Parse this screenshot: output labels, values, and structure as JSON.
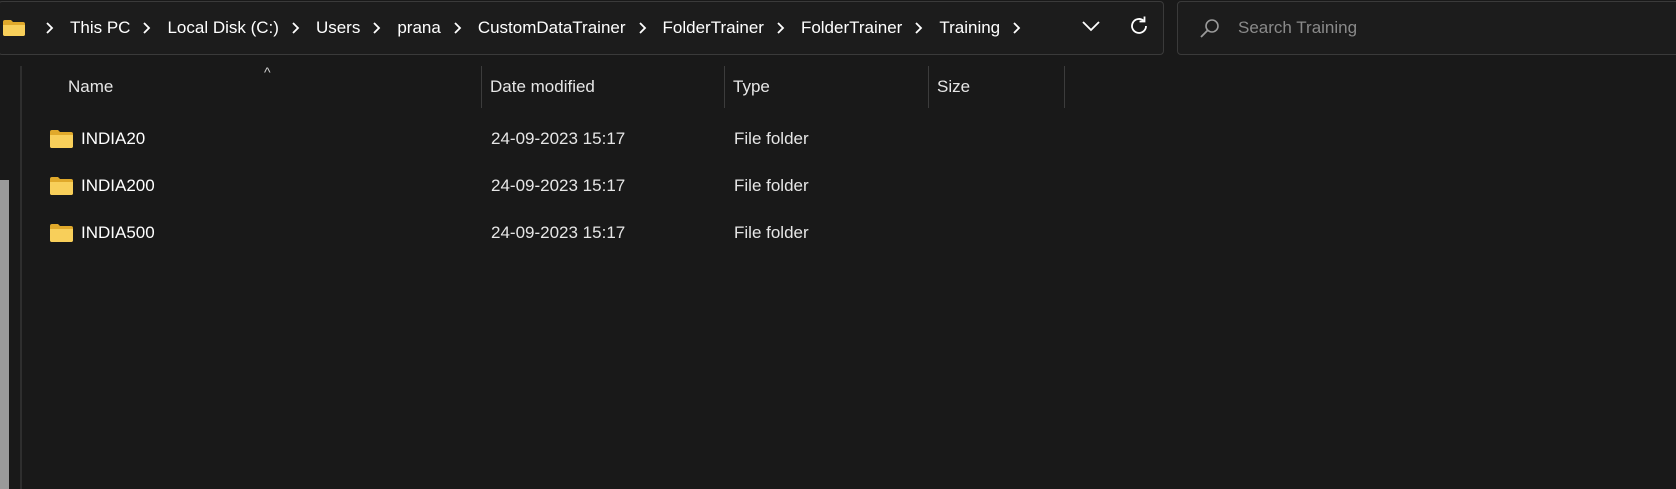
{
  "address_bar": {
    "crumbs": [
      "This PC",
      "Local Disk (C:)",
      "Users",
      "prana",
      "CustomDataTrainer",
      "FolderTrainer",
      "FolderTrainer",
      "Training"
    ]
  },
  "search": {
    "placeholder": "Search Training"
  },
  "columns": {
    "name": "Name",
    "date_modified": "Date modified",
    "type": "Type",
    "size": "Size",
    "sort_indicator": "^"
  },
  "files": [
    {
      "name": "INDIA20",
      "date_modified": "24-09-2023 15:17",
      "type": "File folder",
      "size": ""
    },
    {
      "name": "INDIA200",
      "date_modified": "24-09-2023 15:17",
      "type": "File folder",
      "size": ""
    },
    {
      "name": "INDIA500",
      "date_modified": "24-09-2023 15:17",
      "type": "File folder",
      "size": ""
    }
  ],
  "icons": {
    "folder": "folder-icon",
    "chevron": "chevron-right-icon",
    "dropdown": "chevron-down-icon",
    "refresh": "refresh-icon",
    "search": "search-icon"
  },
  "colors": {
    "background": "#191919",
    "folder_yellow": "#f8cf5a",
    "folder_dark": "#e0a92b",
    "text": "#ffffff",
    "border": "#3a3a3a"
  }
}
